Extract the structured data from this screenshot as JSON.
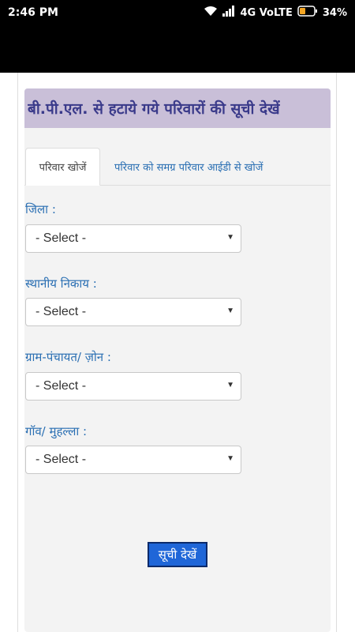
{
  "status": {
    "time": "2:46 PM",
    "network": "4G VoLTE",
    "battery": "34%"
  },
  "panel": {
    "title": "बी.पी.एल. से हटाये गये परिवारों की सूची देखें"
  },
  "tabs": {
    "active": "परिवार खोजें",
    "inactive": "परिवार को समग्र परिवार आईडी से खोजें"
  },
  "fields": [
    {
      "label": "जिला :",
      "value": "- Select -"
    },
    {
      "label": "स्थानीय निकाय :",
      "value": "- Select -"
    },
    {
      "label": "ग्राम-पंचायत/ ज़ोन :",
      "value": "- Select -"
    },
    {
      "label": "गॉव/ मुहल्ला :",
      "value": "- Select -"
    }
  ],
  "submit_label": "सूची देखें"
}
